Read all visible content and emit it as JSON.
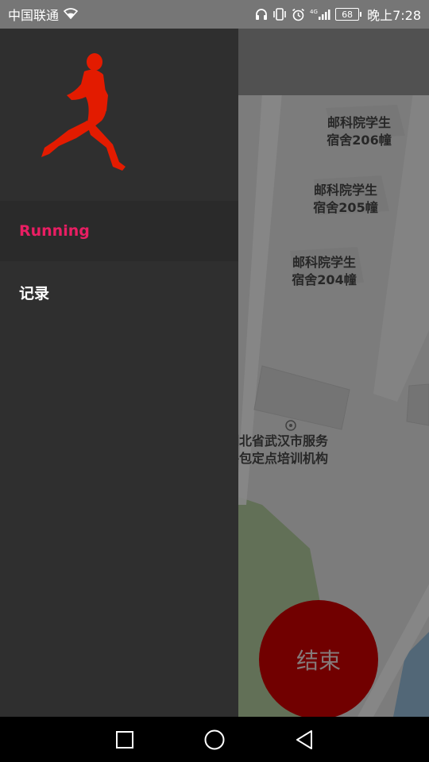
{
  "status_bar": {
    "carrier": "中国联通",
    "battery": "68",
    "time": "晚上7:28",
    "icons": [
      "wifi-icon",
      "headphones-icon",
      "vibrate-icon",
      "alarm-icon",
      "4g-signal-icon",
      "battery-icon"
    ]
  },
  "drawer": {
    "logo": "runner-icon",
    "logo_color": "#e31b00",
    "items": [
      {
        "label": "Running",
        "active": true,
        "color": "#e91e63"
      },
      {
        "label": "记录",
        "active": false,
        "color": "#ffffff"
      }
    ]
  },
  "map": {
    "labels": [
      {
        "line1": "邮科院学生",
        "line2": "宿舍206幢"
      },
      {
        "line1": "邮科院学生",
        "line2": "宿舍205幢"
      },
      {
        "line1": "邮科院学生",
        "line2": "宿舍204幢"
      },
      {
        "line1": "湖北省武汉市服务",
        "line2": "外包定点培训机构"
      }
    ]
  },
  "end_button": {
    "label": "结束",
    "color": "#d50000"
  },
  "nav_bar": {
    "icons": [
      "recent-apps-icon",
      "home-icon",
      "back-icon"
    ]
  }
}
